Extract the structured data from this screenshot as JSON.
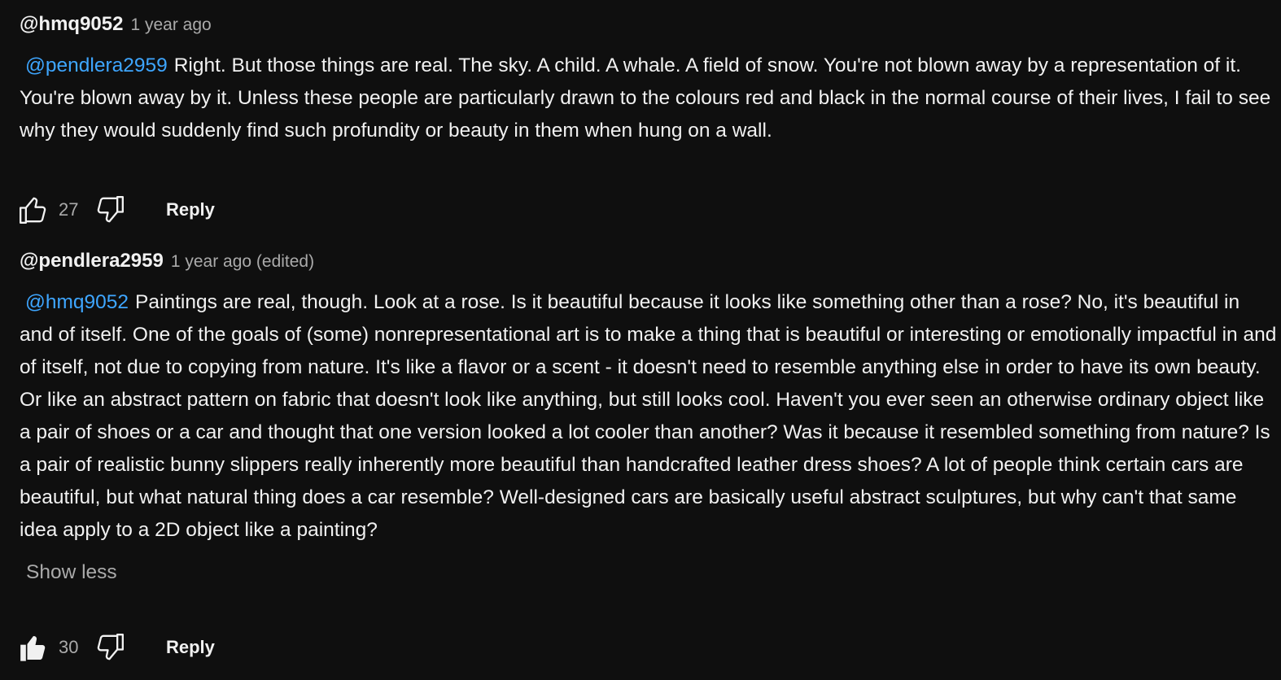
{
  "comments": [
    {
      "author": "@hmq9052",
      "time": "1 year ago",
      "mention": "@pendlera2959",
      "text": "Right. But those things are real. The sky. A child. A whale. A field of snow. You're not blown away by a representation of it. You're blown away by it. Unless these people are particularly drawn to the colours red and black in the normal course of their lives, I fail to see why they would suddenly find such profundity or beauty in them when hung on a wall.",
      "likes": "27",
      "liked": false,
      "reply_label": "Reply",
      "like_icon": "thumbs-up-outline-icon",
      "dislike_icon": "thumbs-down-outline-icon"
    },
    {
      "author": "@pendlera2959",
      "time": "1 year ago (edited)",
      "mention": "@hmq9052",
      "text": "Paintings are real, though. Look at a rose. Is it beautiful because it looks like something other than a rose? No, it's beautiful in and of itself. One of the goals of (some) nonrepresentational art is to make a thing that is beautiful or interesting or emotionally impactful in and of itself, not due to copying from nature. It's like a flavor or a scent - it doesn't need to resemble anything else in order to have its own beauty. Or like an abstract pattern on fabric that doesn't look like anything, but still looks cool. Haven't you ever seen an otherwise ordinary object like a pair of shoes or a car and thought that one version looked a lot cooler than another? Was it because it resembled something from nature? Is a pair of realistic bunny slippers really inherently more beautiful than handcrafted leather dress shoes? A lot of people think certain cars are beautiful, but what natural thing does a car resemble? Well-designed cars are basically useful abstract sculptures, but why can't that same idea apply to a 2D object like a painting?",
      "show_less": "Show less",
      "likes": "30",
      "liked": true,
      "reply_label": "Reply",
      "like_icon": "thumbs-up-filled-icon",
      "dislike_icon": "thumbs-down-outline-icon"
    }
  ],
  "colors": {
    "background": "#0f0f0f",
    "text": "#f1f1f1",
    "secondary": "#aaaaaa",
    "mention": "#3ea6ff"
  }
}
